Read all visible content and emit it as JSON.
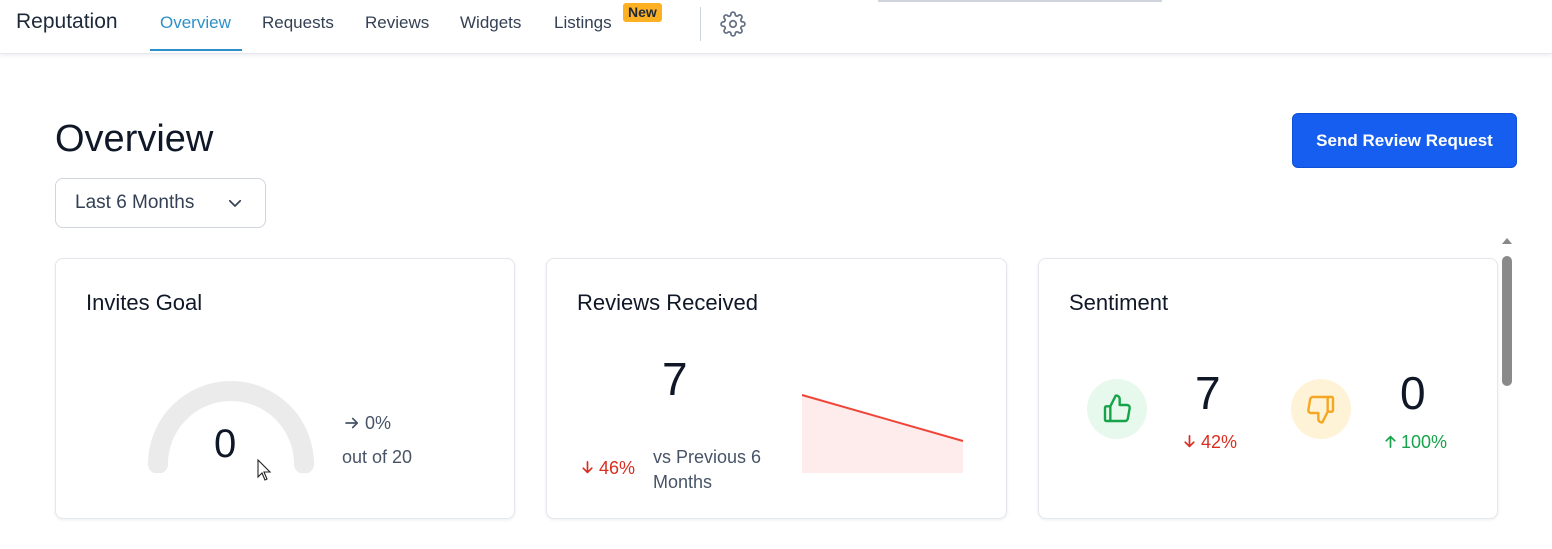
{
  "header": {
    "brand": "Reputation",
    "tabs": [
      {
        "label": "Overview",
        "active": true
      },
      {
        "label": "Requests",
        "active": false
      },
      {
        "label": "Reviews",
        "active": false
      },
      {
        "label": "Widgets",
        "active": false
      },
      {
        "label": "Listings",
        "active": false
      }
    ],
    "new_badge": "New",
    "settings_icon": "gear-icon"
  },
  "page": {
    "title": "Overview",
    "send_button_label": "Send Review Request",
    "date_range": {
      "selected": "Last 6 Months",
      "icon": "chevron-down-icon"
    }
  },
  "cards": {
    "invites": {
      "title": "Invites Goal",
      "value": "0",
      "change": "0%",
      "change_icon": "arrow-right-icon",
      "goal_text": "out of 20",
      "progress_fraction": 0
    },
    "reviews": {
      "title": "Reviews Received",
      "value": "7",
      "change": "46%",
      "change_icon": "arrow-down-icon",
      "comparison_text": "vs Previous 6 Months",
      "trend": "down"
    },
    "sentiment": {
      "title": "Sentiment",
      "positive": {
        "value": "7",
        "change": "42%",
        "change_icon": "arrow-down-icon",
        "icon": "thumbs-up-icon"
      },
      "negative": {
        "value": "0",
        "change": "100%",
        "change_icon": "arrow-up-icon",
        "icon": "thumbs-down-icon"
      }
    }
  },
  "colors": {
    "accent": "#2e90c8",
    "primary_button": "#155eef",
    "badge": "#fdb022",
    "negative": "#d92d20",
    "positive": "#16a34a"
  }
}
